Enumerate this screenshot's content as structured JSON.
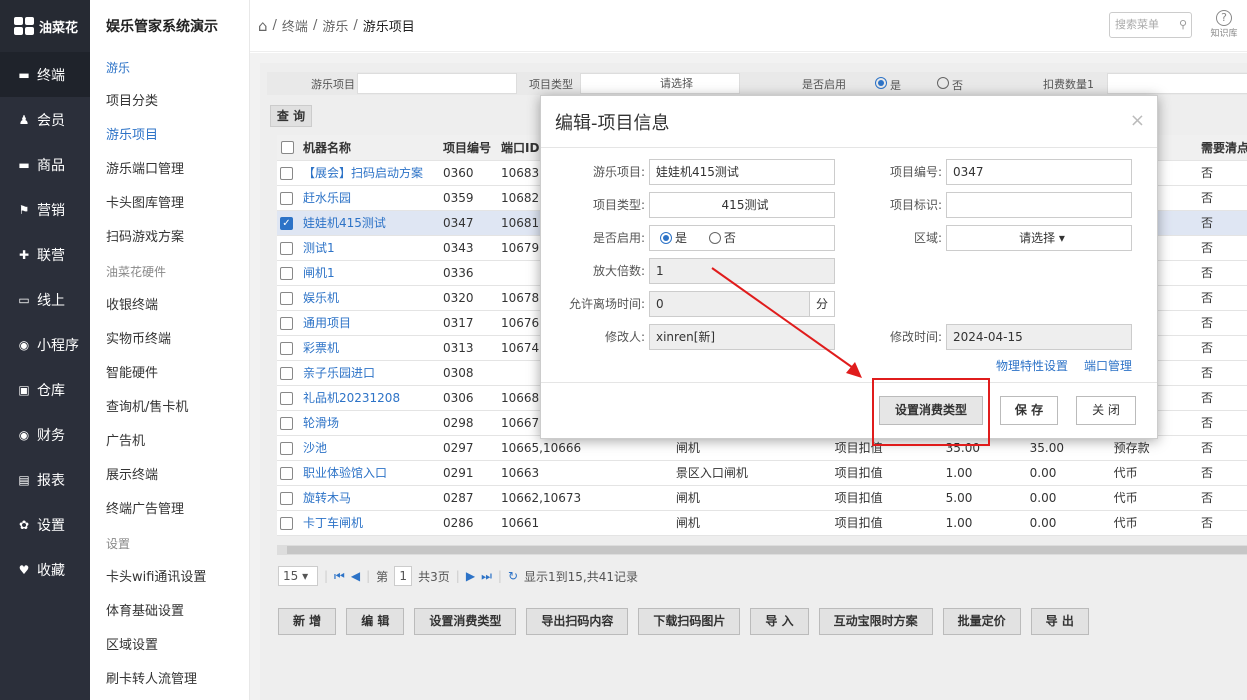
{
  "brand": {
    "logo_text": "油菜花",
    "system_title": "娱乐管家系统演示"
  },
  "left_nav": [
    {
      "icon": "▬",
      "icon_name": "terminal-icon",
      "label": "终端",
      "active": true
    },
    {
      "icon": "♟",
      "icon_name": "member-icon",
      "label": "会员"
    },
    {
      "icon": "▬",
      "icon_name": "product-icon",
      "label": "商品"
    },
    {
      "icon": "⚑",
      "icon_name": "flag-icon",
      "label": "营销"
    },
    {
      "icon": "✚",
      "icon_name": "alliance-icon",
      "label": "联营"
    },
    {
      "icon": "▭",
      "icon_name": "online-icon",
      "label": "线上"
    },
    {
      "icon": "◉",
      "icon_name": "miniprogram-icon",
      "label": "小程序"
    },
    {
      "icon": "▣",
      "icon_name": "warehouse-icon",
      "label": "仓库"
    },
    {
      "icon": "◉",
      "icon_name": "finance-icon",
      "label": "财务"
    },
    {
      "icon": "▤",
      "icon_name": "report-icon",
      "label": "报表"
    },
    {
      "icon": "✿",
      "icon_name": "settings-icon",
      "label": "设置"
    },
    {
      "icon": "♥",
      "icon_name": "heart-icon",
      "label": "收藏"
    }
  ],
  "sub_nav": {
    "g1": "游乐",
    "g1_items": [
      "项目分类",
      "游乐项目",
      "游乐端口管理",
      "卡头图库管理",
      "扫码游戏方案"
    ],
    "g2": "油菜花硬件",
    "g2_items": [
      "收银终端",
      "实物币终端",
      "智能硬件",
      "查询机/售卡机",
      "广告机",
      "展示终端",
      "终端广告管理"
    ],
    "g3": "设置",
    "g3_items": [
      "卡头wifi通讯设置",
      "体育基础设置",
      "区域设置",
      "刷卡转人流管理"
    ]
  },
  "breadcrumb": [
    "终端",
    "游乐",
    "游乐项目"
  ],
  "search": {
    "placeholder": "搜索菜单"
  },
  "help_label": "知识库",
  "filter": {
    "item_label": "游乐项目",
    "type_label": "项目类型",
    "type_value": "请选择",
    "enabled_label": "是否启用",
    "yes": "是",
    "no": "否",
    "deduct_label": "扣费数量1"
  },
  "query_button": "查 询",
  "table": {
    "headers": [
      "机器名称",
      "项目编号",
      "端口ID",
      "",
      "",
      "",
      "",
      "",
      "需要清点币"
    ],
    "rows": [
      [
        "【展会】扫码启动方案",
        "0360",
        "10683",
        "",
        "",
        "",
        "",
        "",
        "否"
      ],
      [
        "赶水乐园",
        "0359",
        "10682",
        "",
        "",
        "",
        "",
        "",
        "否"
      ],
      [
        "娃娃机415测试",
        "0347",
        "10681",
        "",
        "",
        "",
        "",
        "",
        "否"
      ],
      [
        "测试1",
        "0343",
        "10679",
        "",
        "",
        "",
        "",
        "",
        "否"
      ],
      [
        "闸机1",
        "0336",
        "",
        "",
        "",
        "",
        "",
        "",
        "否"
      ],
      [
        "娱乐机",
        "0320",
        "10678,",
        "",
        "",
        "",
        "",
        "",
        "否"
      ],
      [
        "通用项目",
        "0317",
        "10676,",
        "",
        "",
        "",
        "",
        "",
        "否"
      ],
      [
        "彩票机",
        "0313",
        "10674",
        "",
        "",
        "",
        "",
        "",
        "否"
      ],
      [
        "亲子乐园进口",
        "0308",
        "",
        "",
        "",
        "",
        "",
        "",
        "否"
      ],
      [
        "礼品机20231208",
        "0306",
        "10668",
        "",
        "",
        "",
        "",
        "",
        "否"
      ],
      [
        "轮滑场",
        "0298",
        "10667",
        "",
        "",
        "",
        "",
        "",
        "否"
      ],
      [
        "沙池",
        "0297",
        "10665,10666",
        "闸机",
        "项目扣值",
        "35.00",
        "35.00",
        "预存款",
        "否"
      ],
      [
        "职业体验馆入口",
        "0291",
        "10663",
        "景区入口闸机",
        "项目扣值",
        "1.00",
        "0.00",
        "代币",
        "否"
      ],
      [
        "旋转木马",
        "0287",
        "10662,10673",
        "闸机",
        "项目扣值",
        "5.00",
        "0.00",
        "代币",
        "否"
      ],
      [
        "卡丁车闸机",
        "0286",
        "10661",
        "闸机",
        "项目扣值",
        "1.00",
        "0.00",
        "代币",
        "否"
      ]
    ],
    "selected_row": 2
  },
  "pager": {
    "page_size": "15",
    "page_prefix": "第",
    "page": "1",
    "page_total": "共3页",
    "summary": "显示1到15,共41记录"
  },
  "actions": [
    "新 增",
    "编 辑",
    "设置消费类型",
    "导出扫码内容",
    "下载扫码图片",
    "导 入",
    "互动宝限时方案",
    "批量定价",
    "导 出"
  ],
  "modal": {
    "title": "编辑-项目信息",
    "fields": {
      "item_label": "游乐项目:",
      "item_value": "娃娃机415测试",
      "code_label": "项目编号:",
      "code_value": "0347",
      "type_label": "项目类型:",
      "type_value": "415测试",
      "tag_label": "项目标识:",
      "tag_value": "",
      "enabled_label": "是否启用:",
      "yes": "是",
      "no": "否",
      "area_label": "区域:",
      "area_value": "请选择",
      "mult_label": "放大倍数:",
      "mult_value": "1",
      "leave_label": "允许离场时间:",
      "leave_value": "0",
      "leave_unit": "分",
      "modifier_label": "修改人:",
      "modifier_value": "xinren[新]",
      "mtime_label": "修改时间:",
      "mtime_value": "2024-04-15"
    },
    "links": [
      "物理特性设置",
      "端口管理"
    ],
    "buttons": {
      "consume": "设置消费类型",
      "save": "保 存",
      "close": "关 闭"
    }
  },
  "colors": {
    "accent": "#2d73c7",
    "sidebar": "#2b2f3a",
    "highlight": "#e01c1c"
  }
}
